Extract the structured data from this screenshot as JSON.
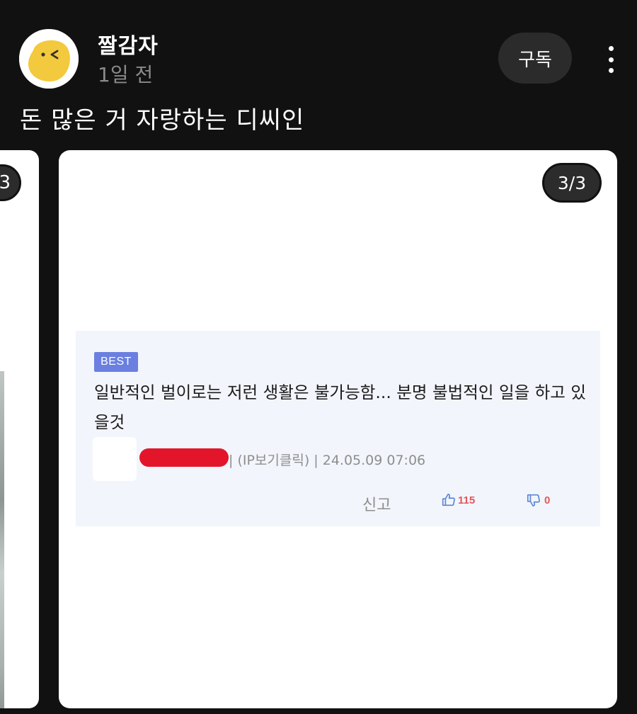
{
  "header": {
    "username": "짤감자",
    "time_ago": "1일 전",
    "subscribe_label": "구독",
    "avatar_icon": "potato-face-avatar",
    "more_icon": "more-vertical-icon"
  },
  "post": {
    "title": "돈 많은 거 자랑하는 디씨인"
  },
  "carousel": {
    "prev_indicator": "3",
    "current_indicator": "3/3"
  },
  "comment": {
    "badge": "BEST",
    "text": "일반적인 벌이로는 저런 생활은 불가능함... 분명 불법적인 일을 하고 있을것",
    "meta": "| (IP보기클릭) | 24.05.09 07:06",
    "report_label": "신고",
    "like_count": "115",
    "dislike_count": "0"
  },
  "colors": {
    "background": "#111111",
    "card": "#ffffff",
    "comment_bg": "#f2f5fb",
    "best_badge": "#6a7fe0",
    "redaction": "#e3152a",
    "count_red": "#e0585b",
    "thumb_blue": "#5b86d6"
  }
}
